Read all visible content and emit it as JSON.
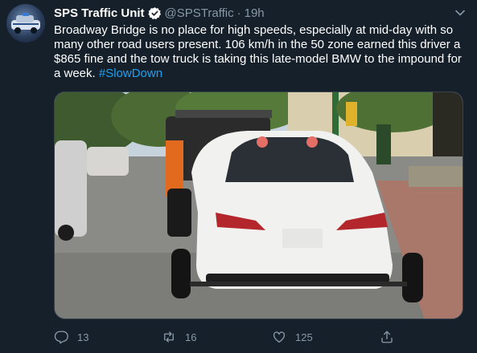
{
  "author": {
    "display_name": "SPS Traffic Unit",
    "handle": "@SPSTraffic",
    "separator": "·",
    "time": "19h"
  },
  "tweet": {
    "text": "Broadway Bridge is no place for high speeds, especially at mid-day with so many other road users present. 106 km/h in the 50 zone earned this driver a $865 fine and the tow truck is taking this late-model BMW to the impound for a week. ",
    "hashtag": "#SlowDown"
  },
  "actions": {
    "replies": "13",
    "retweets": "16",
    "likes": "125"
  },
  "icons": {
    "avatar": "police-car-avatar",
    "verified": "verified-badge-icon",
    "caret": "chevron-down-icon",
    "reply": "reply-icon",
    "retweet": "retweet-icon",
    "like": "heart-icon",
    "share": "share-icon"
  },
  "colors": {
    "background": "#15202b",
    "accent": "#1da1f2",
    "muted": "#8899a6"
  }
}
